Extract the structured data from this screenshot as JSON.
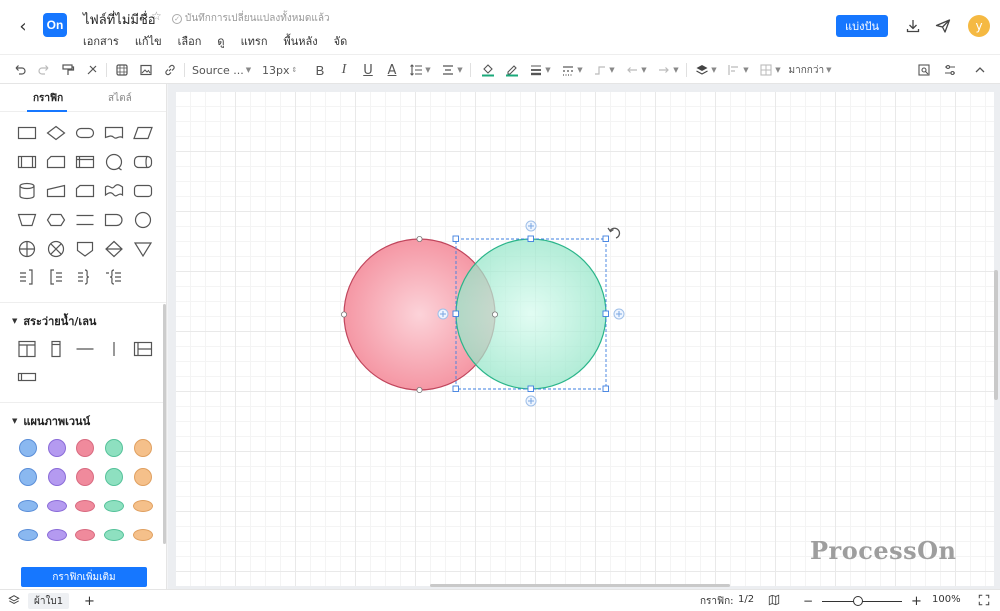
{
  "header": {
    "logo_text": "On",
    "doc_title": "ไฟล์ที่ไม่มีชื่อ",
    "save_status": "บันทึกการเปลี่ยนแปลงทั้งหมดแล้ว",
    "menu": [
      "เอกสาร",
      "แก้ไข",
      "เลือก",
      "ดู",
      "แทรก",
      "พื้นหลัง",
      "จัด"
    ],
    "share_label": "แบ่งปัน",
    "avatar_letter": "y"
  },
  "toolbar": {
    "font_name": "Source ...",
    "font_size": "13px",
    "bold": "B",
    "italic": "I",
    "underline": "U",
    "font_color": "A",
    "more_label": "มากกว่า"
  },
  "sidebar": {
    "tabs": [
      "กราฟิก",
      "สไตล์"
    ],
    "sections": [
      "สระว่ายน้ำ/เลน",
      "แผนภาพเวนน์"
    ],
    "more_shapes_button": "กราฟิกเพิ่มเติม",
    "venn_colors": [
      "#8ab8f0",
      "#b49af0",
      "#f08a9c",
      "#8ee0c0",
      "#f5c08a"
    ]
  },
  "canvas": {
    "watermark": "ProcessOn",
    "circle_left_color": "#f7a6b0",
    "circle_right_color": "#a8ecd2",
    "selection_color": "#1677ff"
  },
  "statusbar": {
    "page_tab": "ผ้าใบ1",
    "add_page": "+",
    "graphics_label": "กราฟิก:",
    "graphics_count": "1/2",
    "zoom_minus": "−",
    "zoom_plus": "+",
    "zoom_value": "100%"
  }
}
